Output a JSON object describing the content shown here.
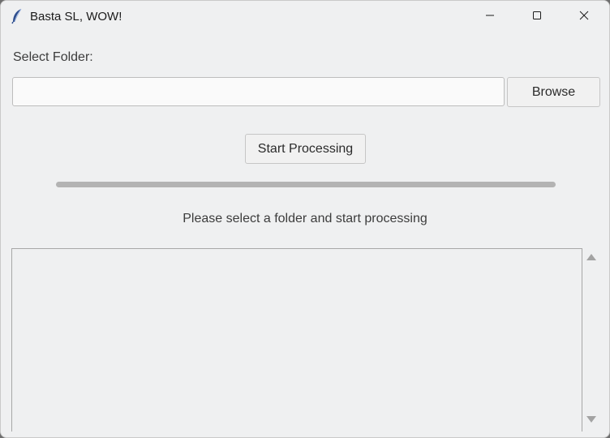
{
  "window": {
    "title": "Basta SL, WOW!",
    "icon": "feather-icon",
    "controls": [
      "minimize-icon",
      "maximize-icon",
      "close-icon"
    ]
  },
  "folder": {
    "label": "Select Folder:",
    "value": "",
    "placeholder": ""
  },
  "buttons": {
    "browse": "Browse",
    "start": "Start Processing"
  },
  "progress": {
    "fraction": 0
  },
  "status": {
    "text": "Please select a folder and start processing"
  },
  "log": {
    "content": ""
  },
  "colors": {
    "background": "#eff0f1",
    "progress_track": "#b3b3b3"
  }
}
